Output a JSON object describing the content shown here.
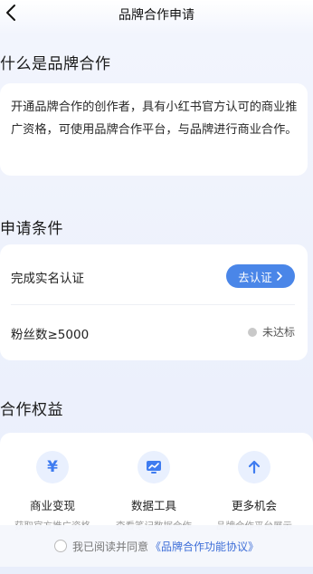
{
  "nav": {
    "title": "品牌合作申请"
  },
  "intro": {
    "title": "什么是品牌合作",
    "text": "开通品牌合作的创作者，具有小红书官方认可的商业推广资格，可使用品牌合作平台，与品牌进行商业合作。"
  },
  "conditions": {
    "title": "申请条件",
    "items": [
      {
        "label": "完成实名认证",
        "action": "去认证"
      },
      {
        "label": "粉丝数≥5000",
        "status": "未达标"
      }
    ]
  },
  "benefits": {
    "title": "合作权益",
    "items": [
      {
        "icon": "yen-icon",
        "label": "商业变现",
        "sub": "获取官方推广资格"
      },
      {
        "icon": "chart-icon",
        "label": "数据工具",
        "sub": "查看笔记数据合作"
      },
      {
        "icon": "up-arrow-icon",
        "label": "更多机会",
        "sub": "品牌合作平台展示"
      }
    ]
  },
  "agreement": {
    "prefix": "我已阅读并同意",
    "link": "《品牌合作功能协议》"
  },
  "colors": {
    "accent": "#4a86e8",
    "link": "#3f6fd8"
  }
}
